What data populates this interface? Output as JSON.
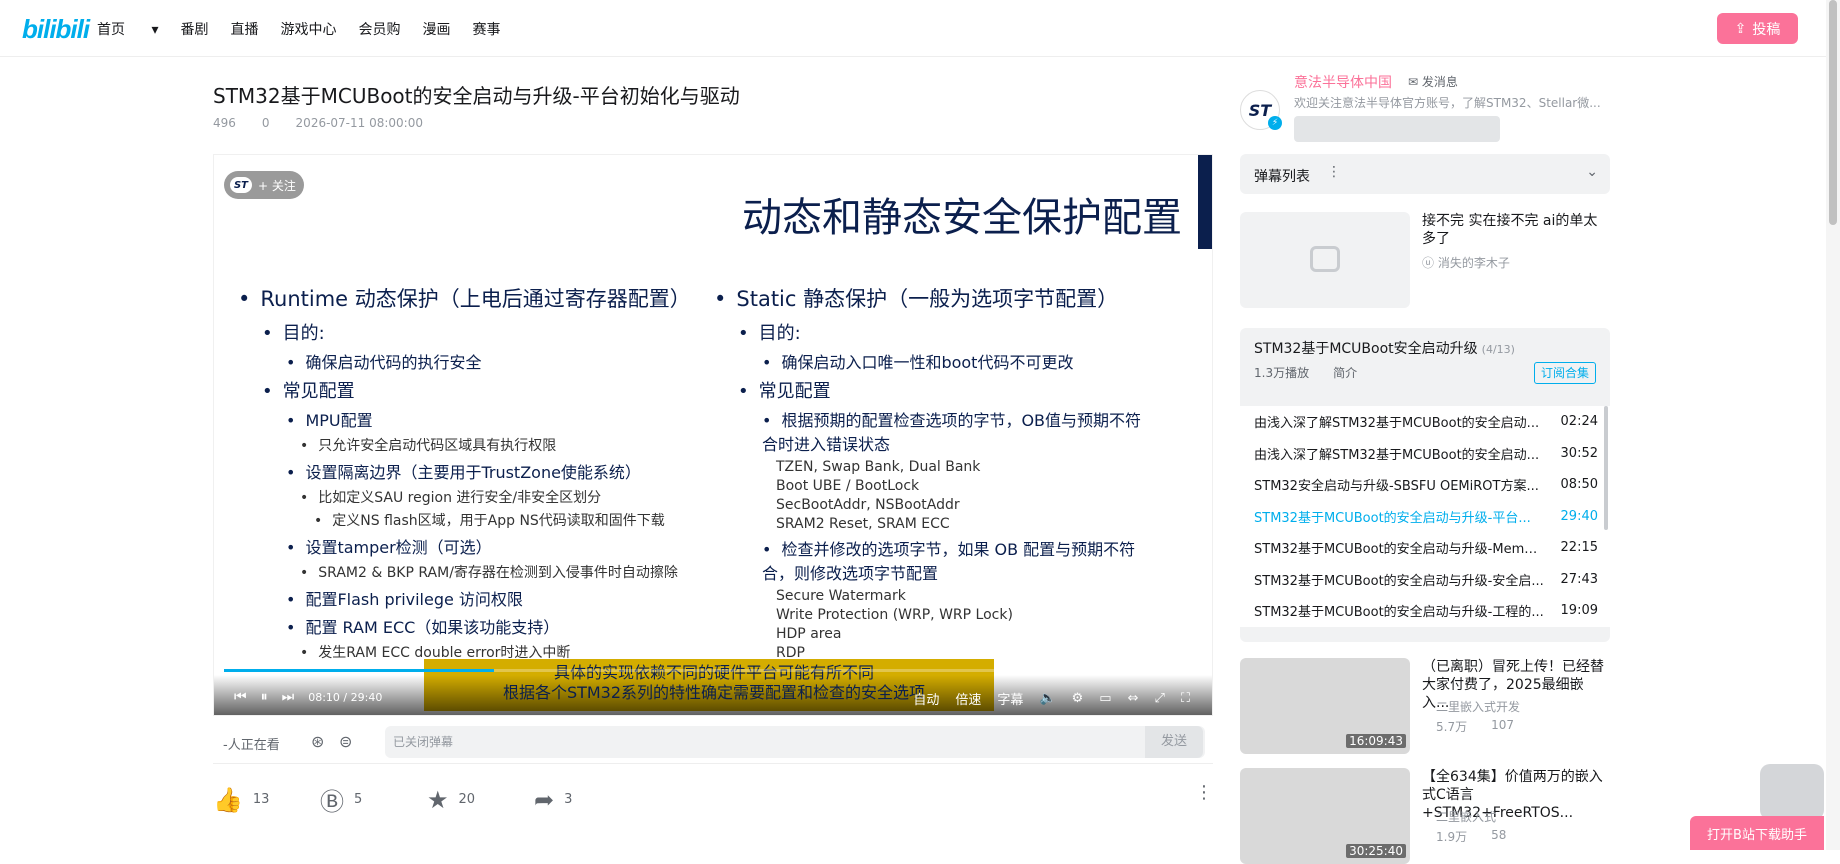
{
  "header": {
    "logo": "bilibili",
    "nav": [
      "首页",
      "番剧",
      "直播",
      "游戏中心",
      "会员购",
      "漫画",
      "赛事"
    ],
    "upload_label": "投稿"
  },
  "video": {
    "title": "STM32基于MCUBoot的安全启动与升级-平台初始化与驱动",
    "views": "496",
    "danmaku": "0",
    "date": "2026-07-11 08:00:00"
  },
  "slide": {
    "follow_label": "+ 关注",
    "heading": "动态和静态安全保护配置",
    "left": {
      "l1": "Runtime 动态保护（上电后通过寄存器配置）",
      "goal": "目的:",
      "goal_item": "确保启动代码的执行安全",
      "common": "常见配置",
      "mpu": "MPU配置",
      "mpu_sub": "只允许安全启动代码区域具有执行权限",
      "iso": "设置隔离边界（主要用于TrustZone使能系统）",
      "iso_sub1": "比如定义SAU region 进行安全/非安全区划分",
      "iso_sub2": "定义NS flash区域，用于App NS代码读取和固件下载",
      "tamper": "设置tamper检测（可选）",
      "tamper_sub": "SRAM2 & BKP RAM/寄存器在检测到入侵事件时自动擦除",
      "flash": "配置Flash privilege 访问权限",
      "ram": "配置 RAM ECC（如果该功能支持）",
      "ram_sub": "发生RAM ECC double error时进入中断"
    },
    "right": {
      "l1": "Static 静态保护（一般为选项字节配置）",
      "goal": "目的:",
      "goal_item": "确保启动入口唯一性和boot代码不可更改",
      "common": "常见配置",
      "ob1": "根据预期的配置检查选项的字节，OB值与预期不符合时进入错误状态",
      "ob1_items": [
        "TZEN, Swap Bank, Dual Bank",
        "Boot UBE / BootLock",
        "SecBootAddr, NSBootAddr",
        "SRAM2 Reset, SRAM ECC"
      ],
      "ob2": "检查并修改的选项字节，如果 OB 配置与预期不符合，则修改选项字节配置",
      "ob2_items": [
        "Secure Watermark",
        "Write Protection (WRP, WRP Lock)",
        "HDP area",
        "RDP"
      ]
    },
    "subtitle_1": "具体的实现依赖不同的硬件平台可能有所不同",
    "subtitle_2": "根据各个STM32系列的特性确定需要配置和检查的安全选项"
  },
  "player": {
    "time": "08:10 / 29:40",
    "progress": 0.275,
    "quality": "自动",
    "speed": "倍速",
    "subtitle_btn": "字幕"
  },
  "danmu_bar": {
    "watching": "-人正在看",
    "placeholder": "已关闭弹幕",
    "send": "发送"
  },
  "actions": {
    "like": "13",
    "coin": "5",
    "favorite": "20",
    "share": "3"
  },
  "up": {
    "name": "意法半导体中国",
    "message": "发消息",
    "desc": "欢迎关注意法半导体官方账号，了解STM32、Stellar微..."
  },
  "danmu_list": {
    "label": "弹幕列表"
  },
  "rec1": {
    "title": "接不完 实在接不完 ai的单太多了",
    "up": "消失的李木子"
  },
  "playlist": {
    "title": "STM32基于MCUBoot安全启动升级",
    "count": "(4/13)",
    "plays": "1.3万播放",
    "intro": "简介",
    "subscribe": "订阅合集",
    "items": [
      {
        "name": "由浅入深了解STM32基于MCUBoot的安全启动...",
        "dur": "02:24"
      },
      {
        "name": "由浅入深了解STM32基于MCUBoot的安全启动...",
        "dur": "30:52"
      },
      {
        "name": "STM32安全启动与升级-SBSFU OEMiROT方案...",
        "dur": "08:50"
      },
      {
        "name": "STM32基于MCUBoot的安全启动与升级-平台...",
        "dur": "29:40"
      },
      {
        "name": "STM32基于MCUBoot的安全启动与升级-Memor...",
        "dur": "22:15"
      },
      {
        "name": "STM32基于MCUBoot的安全启动与升级-安全启...",
        "dur": "27:43"
      },
      {
        "name": "STM32基于MCUBoot的安全启动与升级-工程的...",
        "dur": "19:09"
      }
    ]
  },
  "rec2": {
    "title": "（已离职）冒死上传！已经替大家付费了，2025最细嵌入...",
    "up": "二里嵌入式开发",
    "views": "5.7万",
    "dm": "107",
    "dur": "16:09:43"
  },
  "rec3": {
    "title": "【全634集】价值两万的嵌入式C语言+STM32+FreeRTOS...",
    "up": "二里嵌入式",
    "views": "1.9万",
    "dm": "58",
    "dur": "30:25:40"
  },
  "download_label": "打开B站下载助手"
}
